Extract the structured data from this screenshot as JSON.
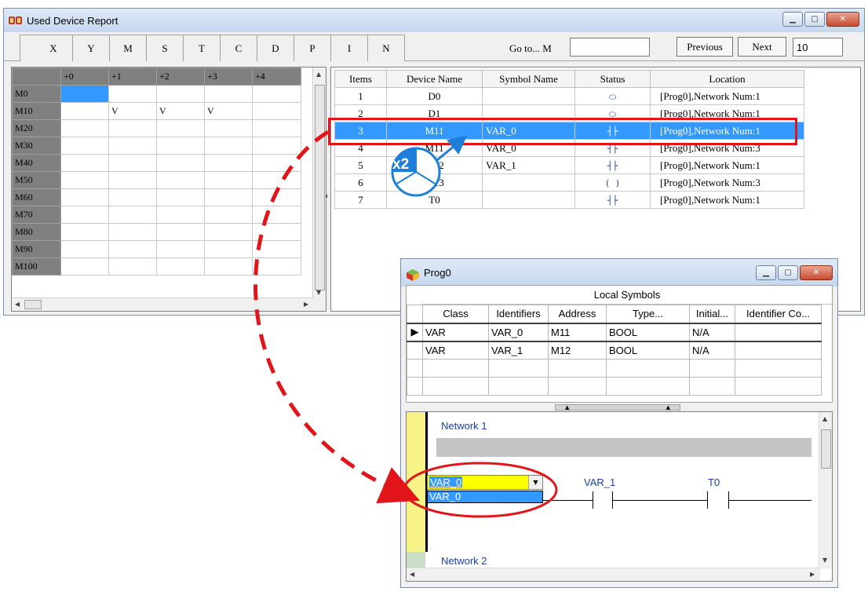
{
  "report_window": {
    "title": "Used Device Report",
    "tabs": [
      "X",
      "Y",
      "M",
      "S",
      "T",
      "C",
      "D",
      "P",
      "I",
      "N"
    ],
    "goto_label": "Go to... M",
    "goto_value": "",
    "previous_label": "Previous",
    "next_label": "Next",
    "page_value": "10",
    "grid": {
      "columns": [
        "+0",
        "+1",
        "+2",
        "+3",
        "+4"
      ],
      "rows": [
        {
          "label": "M0",
          "cells": [
            "",
            "",
            "",
            "",
            ""
          ]
        },
        {
          "label": "M10",
          "cells": [
            "",
            "V",
            "V",
            "V",
            ""
          ]
        },
        {
          "label": "M20",
          "cells": [
            "",
            "",
            "",
            "",
            ""
          ]
        },
        {
          "label": "M30",
          "cells": [
            "",
            "",
            "",
            "",
            ""
          ]
        },
        {
          "label": "M40",
          "cells": [
            "",
            "",
            "",
            "",
            ""
          ]
        },
        {
          "label": "M50",
          "cells": [
            "",
            "",
            "",
            "",
            ""
          ]
        },
        {
          "label": "M60",
          "cells": [
            "",
            "",
            "",
            "",
            ""
          ]
        },
        {
          "label": "M70",
          "cells": [
            "",
            "",
            "",
            "",
            ""
          ]
        },
        {
          "label": "M80",
          "cells": [
            "",
            "",
            "",
            "",
            ""
          ]
        },
        {
          "label": "M90",
          "cells": [
            "",
            "",
            "",
            "",
            ""
          ]
        },
        {
          "label": "M100",
          "cells": [
            "",
            "",
            "",
            "",
            ""
          ]
        }
      ]
    },
    "list": {
      "headers": [
        "Items",
        "Device Name",
        "Symbol Name",
        "Status",
        "Location"
      ],
      "rows": [
        {
          "item": "1",
          "device": "D0",
          "symbol": "",
          "status": "coil-icon",
          "location": "[Prog0],Network Num:1"
        },
        {
          "item": "2",
          "device": "D1",
          "symbol": "",
          "status": "coil-icon",
          "location": "[Prog0],Network Num:1"
        },
        {
          "item": "3",
          "device": "M11",
          "symbol": "VAR_0",
          "status": "contact-icon",
          "location": "[Prog0],Network Num:1"
        },
        {
          "item": "4",
          "device": "M11",
          "symbol": "VAR_0",
          "status": "contact-icon",
          "location": "[Prog0],Network Num:3"
        },
        {
          "item": "5",
          "device": "M12",
          "symbol": "VAR_1",
          "status": "contact-icon",
          "location": "[Prog0],Network Num:1"
        },
        {
          "item": "6",
          "device": "M13",
          "symbol": "",
          "status": "output-icon",
          "location": "[Prog0],Network Num:3"
        },
        {
          "item": "7",
          "device": "T0",
          "symbol": "",
          "status": "contact-icon",
          "location": "[Prog0],Network Num:1"
        }
      ]
    }
  },
  "badge_label": "x2",
  "prog_window": {
    "title": "Prog0",
    "symbols_caption": "Local Symbols",
    "symbol_headers": [
      "Class",
      "Identifiers",
      "Address",
      "Type...",
      "Initial...",
      "Identifier Co..."
    ],
    "symbol_rows": [
      {
        "class": "VAR",
        "id": "VAR_0",
        "address": "M11",
        "type": "BOOL",
        "initial": "N/A",
        "comment": ""
      },
      {
        "class": "VAR",
        "id": "VAR_1",
        "address": "M12",
        "type": "BOOL",
        "initial": "N/A",
        "comment": ""
      }
    ],
    "network1_label": "Network 1",
    "network2_label": "Network 2",
    "combo_value": "VAR_0",
    "combo_option": "VAR_0",
    "contact2_label": "VAR_1",
    "contact3_label": "T0"
  },
  "colors": {
    "selection": "#3399ff",
    "highlight_red": "#e2151b",
    "ladder_blue": "#1a3fa6",
    "gutter_yellow": "#f7f387"
  }
}
